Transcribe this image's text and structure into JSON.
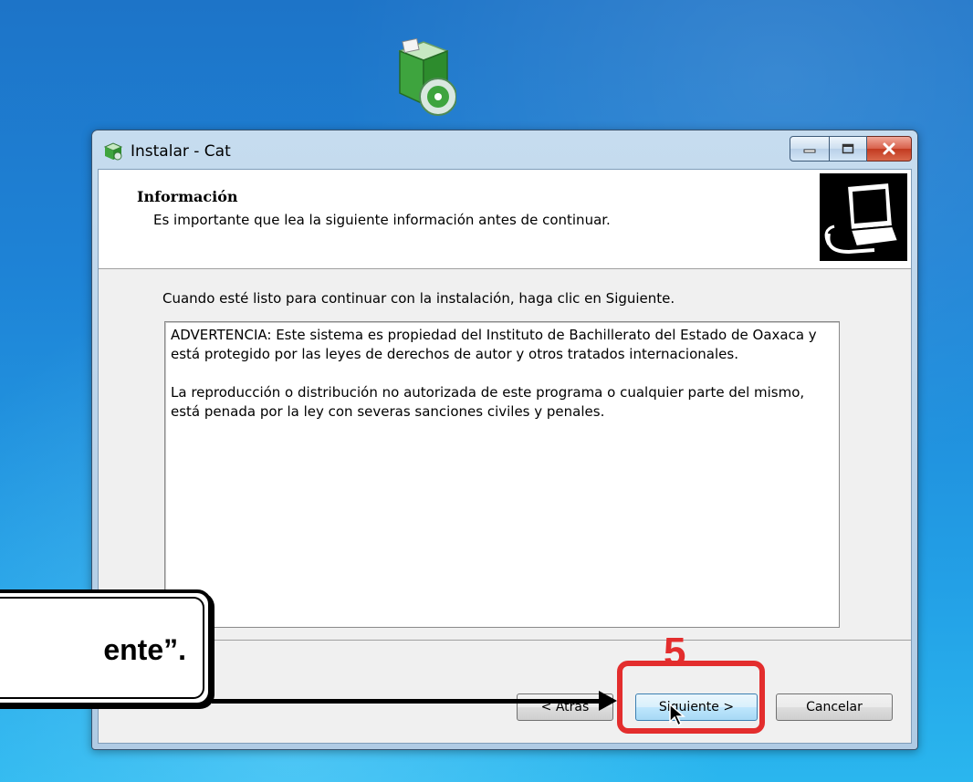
{
  "window": {
    "title": "Instalar - Cat"
  },
  "header": {
    "title": "Información",
    "subtitle": "Es importante que lea la siguiente información antes de continuar."
  },
  "body": {
    "instruction": "Cuando esté listo para continuar con la instalación, haga clic en Siguiente.",
    "memo_paragraphs": [
      "ADVERTENCIA: Este sistema es propiedad del Instituto de Bachillerato del Estado de Oaxaca y está protegido por las leyes de derechos de autor y otros tratados internacionales.",
      "La reproducción o distribución no autorizada de este programa o cualquier parte del mismo, está penada por la ley con severas sanciones civiles y penales."
    ]
  },
  "buttons": {
    "back": "< Atrás",
    "next": "Siguiente >",
    "cancel": "Cancelar"
  },
  "annotation": {
    "callout_text": "ente”.",
    "step_number": "5",
    "highlight_color": "#e32d2d"
  }
}
